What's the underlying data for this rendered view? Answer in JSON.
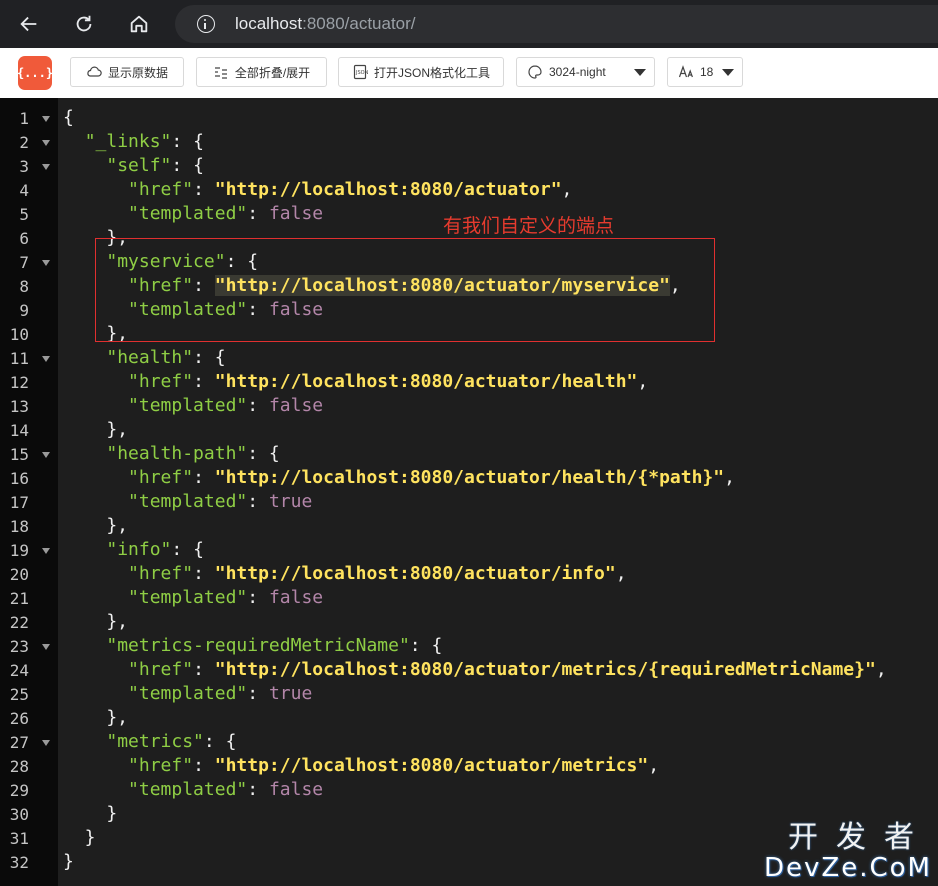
{
  "browser": {
    "url_host": "localhost",
    "url_rest": ":8080/actuator/"
  },
  "toolbar": {
    "logo_text": "{...}",
    "show_raw_label": "显示原数据",
    "fold_label": "全部折叠/展开",
    "format_tool_label": "打开JSON格式化工具",
    "theme_value": "3024-night",
    "font_size_value": "18"
  },
  "annotation": {
    "text": "有我们自定义的端点"
  },
  "watermark": {
    "top": "开发者",
    "bottom": "DevZe.CoM"
  },
  "lines": [
    {
      "n": "1",
      "fold": true,
      "tokens": [
        [
          "p",
          "{"
        ]
      ]
    },
    {
      "n": "2",
      "fold": true,
      "tokens": [
        [
          "p",
          "  "
        ],
        [
          "k",
          "\"_links\""
        ],
        [
          "p",
          ": {"
        ]
      ]
    },
    {
      "n": "3",
      "fold": true,
      "tokens": [
        [
          "p",
          "    "
        ],
        [
          "k",
          "\"self\""
        ],
        [
          "p",
          ": {"
        ]
      ]
    },
    {
      "n": "4",
      "fold": false,
      "tokens": [
        [
          "p",
          "      "
        ],
        [
          "k",
          "\"href\""
        ],
        [
          "p",
          ": "
        ],
        [
          "s",
          "\"http://localhost:8080/actuator\""
        ],
        [
          "p",
          ","
        ]
      ]
    },
    {
      "n": "5",
      "fold": false,
      "tokens": [
        [
          "p",
          "      "
        ],
        [
          "k",
          "\"templated\""
        ],
        [
          "p",
          ": "
        ],
        [
          "b",
          "false"
        ]
      ]
    },
    {
      "n": "6",
      "fold": false,
      "tokens": [
        [
          "p",
          "    },"
        ]
      ]
    },
    {
      "n": "7",
      "fold": true,
      "tokens": [
        [
          "p",
          "    "
        ],
        [
          "k",
          "\"myservice\""
        ],
        [
          "p",
          ": {"
        ]
      ]
    },
    {
      "n": "8",
      "fold": false,
      "tokens": [
        [
          "p",
          "      "
        ],
        [
          "k",
          "\"href\""
        ],
        [
          "p",
          ": "
        ],
        [
          "s",
          "\"http://localhost:8080/actuator/myservice\""
        ],
        [
          "p",
          ","
        ]
      ]
    },
    {
      "n": "9",
      "fold": false,
      "tokens": [
        [
          "p",
          "      "
        ],
        [
          "k",
          "\"templated\""
        ],
        [
          "p",
          ": "
        ],
        [
          "b",
          "false"
        ]
      ]
    },
    {
      "n": "10",
      "fold": false,
      "tokens": [
        [
          "p",
          "    },"
        ]
      ]
    },
    {
      "n": "11",
      "fold": true,
      "tokens": [
        [
          "p",
          "    "
        ],
        [
          "k",
          "\"health\""
        ],
        [
          "p",
          ": {"
        ]
      ]
    },
    {
      "n": "12",
      "fold": false,
      "tokens": [
        [
          "p",
          "      "
        ],
        [
          "k",
          "\"href\""
        ],
        [
          "p",
          ": "
        ],
        [
          "s",
          "\"http://localhost:8080/actuator/health\""
        ],
        [
          "p",
          ","
        ]
      ]
    },
    {
      "n": "13",
      "fold": false,
      "tokens": [
        [
          "p",
          "      "
        ],
        [
          "k",
          "\"templated\""
        ],
        [
          "p",
          ": "
        ],
        [
          "b",
          "false"
        ]
      ]
    },
    {
      "n": "14",
      "fold": false,
      "tokens": [
        [
          "p",
          "    },"
        ]
      ]
    },
    {
      "n": "15",
      "fold": true,
      "tokens": [
        [
          "p",
          "    "
        ],
        [
          "k",
          "\"health-path\""
        ],
        [
          "p",
          ": {"
        ]
      ]
    },
    {
      "n": "16",
      "fold": false,
      "tokens": [
        [
          "p",
          "      "
        ],
        [
          "k",
          "\"href\""
        ],
        [
          "p",
          ": "
        ],
        [
          "s",
          "\"http://localhost:8080/actuator/health/{*path}\""
        ],
        [
          "p",
          ","
        ]
      ]
    },
    {
      "n": "17",
      "fold": false,
      "tokens": [
        [
          "p",
          "      "
        ],
        [
          "k",
          "\"templated\""
        ],
        [
          "p",
          ": "
        ],
        [
          "b",
          "true"
        ]
      ]
    },
    {
      "n": "18",
      "fold": false,
      "tokens": [
        [
          "p",
          "    },"
        ]
      ]
    },
    {
      "n": "19",
      "fold": true,
      "tokens": [
        [
          "p",
          "    "
        ],
        [
          "k",
          "\"info\""
        ],
        [
          "p",
          ": {"
        ]
      ]
    },
    {
      "n": "20",
      "fold": false,
      "tokens": [
        [
          "p",
          "      "
        ],
        [
          "k",
          "\"href\""
        ],
        [
          "p",
          ": "
        ],
        [
          "s",
          "\"http://localhost:8080/actuator/info\""
        ],
        [
          "p",
          ","
        ]
      ]
    },
    {
      "n": "21",
      "fold": false,
      "tokens": [
        [
          "p",
          "      "
        ],
        [
          "k",
          "\"templated\""
        ],
        [
          "p",
          ": "
        ],
        [
          "b",
          "false"
        ]
      ]
    },
    {
      "n": "22",
      "fold": false,
      "tokens": [
        [
          "p",
          "    },"
        ]
      ]
    },
    {
      "n": "23",
      "fold": true,
      "tokens": [
        [
          "p",
          "    "
        ],
        [
          "k",
          "\"metrics-requiredMetricName\""
        ],
        [
          "p",
          ": {"
        ]
      ]
    },
    {
      "n": "24",
      "fold": false,
      "tokens": [
        [
          "p",
          "      "
        ],
        [
          "k",
          "\"href\""
        ],
        [
          "p",
          ": "
        ],
        [
          "s",
          "\"http://localhost:8080/actuator/metrics/{requiredMetricName}\""
        ],
        [
          "p",
          ","
        ]
      ]
    },
    {
      "n": "25",
      "fold": false,
      "tokens": [
        [
          "p",
          "      "
        ],
        [
          "k",
          "\"templated\""
        ],
        [
          "p",
          ": "
        ],
        [
          "b",
          "true"
        ]
      ]
    },
    {
      "n": "26",
      "fold": false,
      "tokens": [
        [
          "p",
          "    },"
        ]
      ]
    },
    {
      "n": "27",
      "fold": true,
      "tokens": [
        [
          "p",
          "    "
        ],
        [
          "k",
          "\"metrics\""
        ],
        [
          "p",
          ": {"
        ]
      ]
    },
    {
      "n": "28",
      "fold": false,
      "tokens": [
        [
          "p",
          "      "
        ],
        [
          "k",
          "\"href\""
        ],
        [
          "p",
          ": "
        ],
        [
          "s",
          "\"http://localhost:8080/actuator/metrics\""
        ],
        [
          "p",
          ","
        ]
      ]
    },
    {
      "n": "29",
      "fold": false,
      "tokens": [
        [
          "p",
          "      "
        ],
        [
          "k",
          "\"templated\""
        ],
        [
          "p",
          ": "
        ],
        [
          "b",
          "false"
        ]
      ]
    },
    {
      "n": "30",
      "fold": false,
      "tokens": [
        [
          "p",
          "    }"
        ]
      ]
    },
    {
      "n": "31",
      "fold": false,
      "tokens": [
        [
          "p",
          "  }"
        ]
      ]
    },
    {
      "n": "32",
      "fold": false,
      "tokens": [
        [
          "p",
          "}"
        ]
      ]
    }
  ]
}
